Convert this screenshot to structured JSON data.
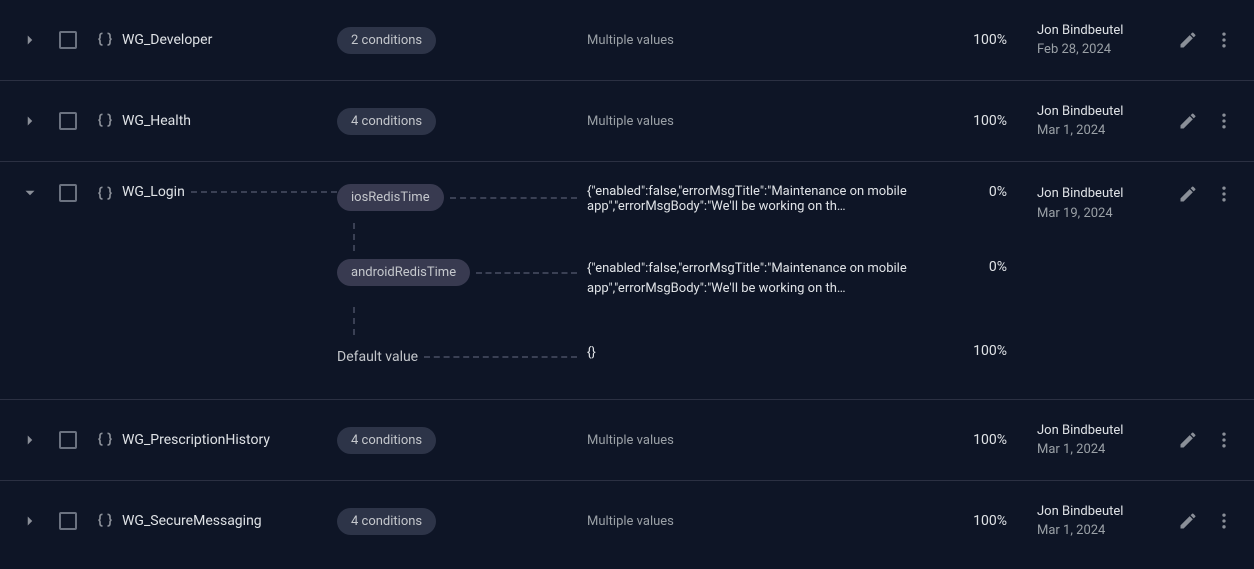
{
  "rows": {
    "0": {
      "name": "WG_Developer",
      "conditions": "2 conditions",
      "value": "Multiple values",
      "percent": "100%",
      "author": "Jon Bindbeutel",
      "date": "Feb 28, 2024"
    },
    "1": {
      "name": "WG_Health",
      "conditions": "4 conditions",
      "value": "Multiple values",
      "percent": "100%",
      "author": "Jon Bindbeutel",
      "date": "Mar 1, 2024"
    },
    "2": {
      "name": "WG_Login",
      "author": "Jon Bindbeutel",
      "date": "Mar 19, 2024",
      "sub": {
        "0": {
          "cond": "iosRedisTime",
          "value": "{\"enabled\":false,\"errorMsgTitle\":\"Maintenance on mobile app\",\"errorMsgBody\":\"We'll be working on th…",
          "percent": "0%"
        },
        "1": {
          "cond": "androidRedisTime",
          "value": "{\"enabled\":false,\"errorMsgTitle\":\"Maintenance on mobile app\",\"errorMsgBody\":\"We'll be working on th…",
          "percent": "0%"
        },
        "2": {
          "cond": "Default value",
          "value": "{}",
          "percent": "100%"
        }
      }
    },
    "3": {
      "name": "WG_PrescriptionHistory",
      "conditions": "4 conditions",
      "value": "Multiple values",
      "percent": "100%",
      "author": "Jon Bindbeutel",
      "date": "Mar 1, 2024"
    },
    "4": {
      "name": "WG_SecureMessaging",
      "conditions": "4 conditions",
      "value": "Multiple values",
      "percent": "100%",
      "author": "Jon Bindbeutel",
      "date": "Mar 1, 2024"
    }
  }
}
